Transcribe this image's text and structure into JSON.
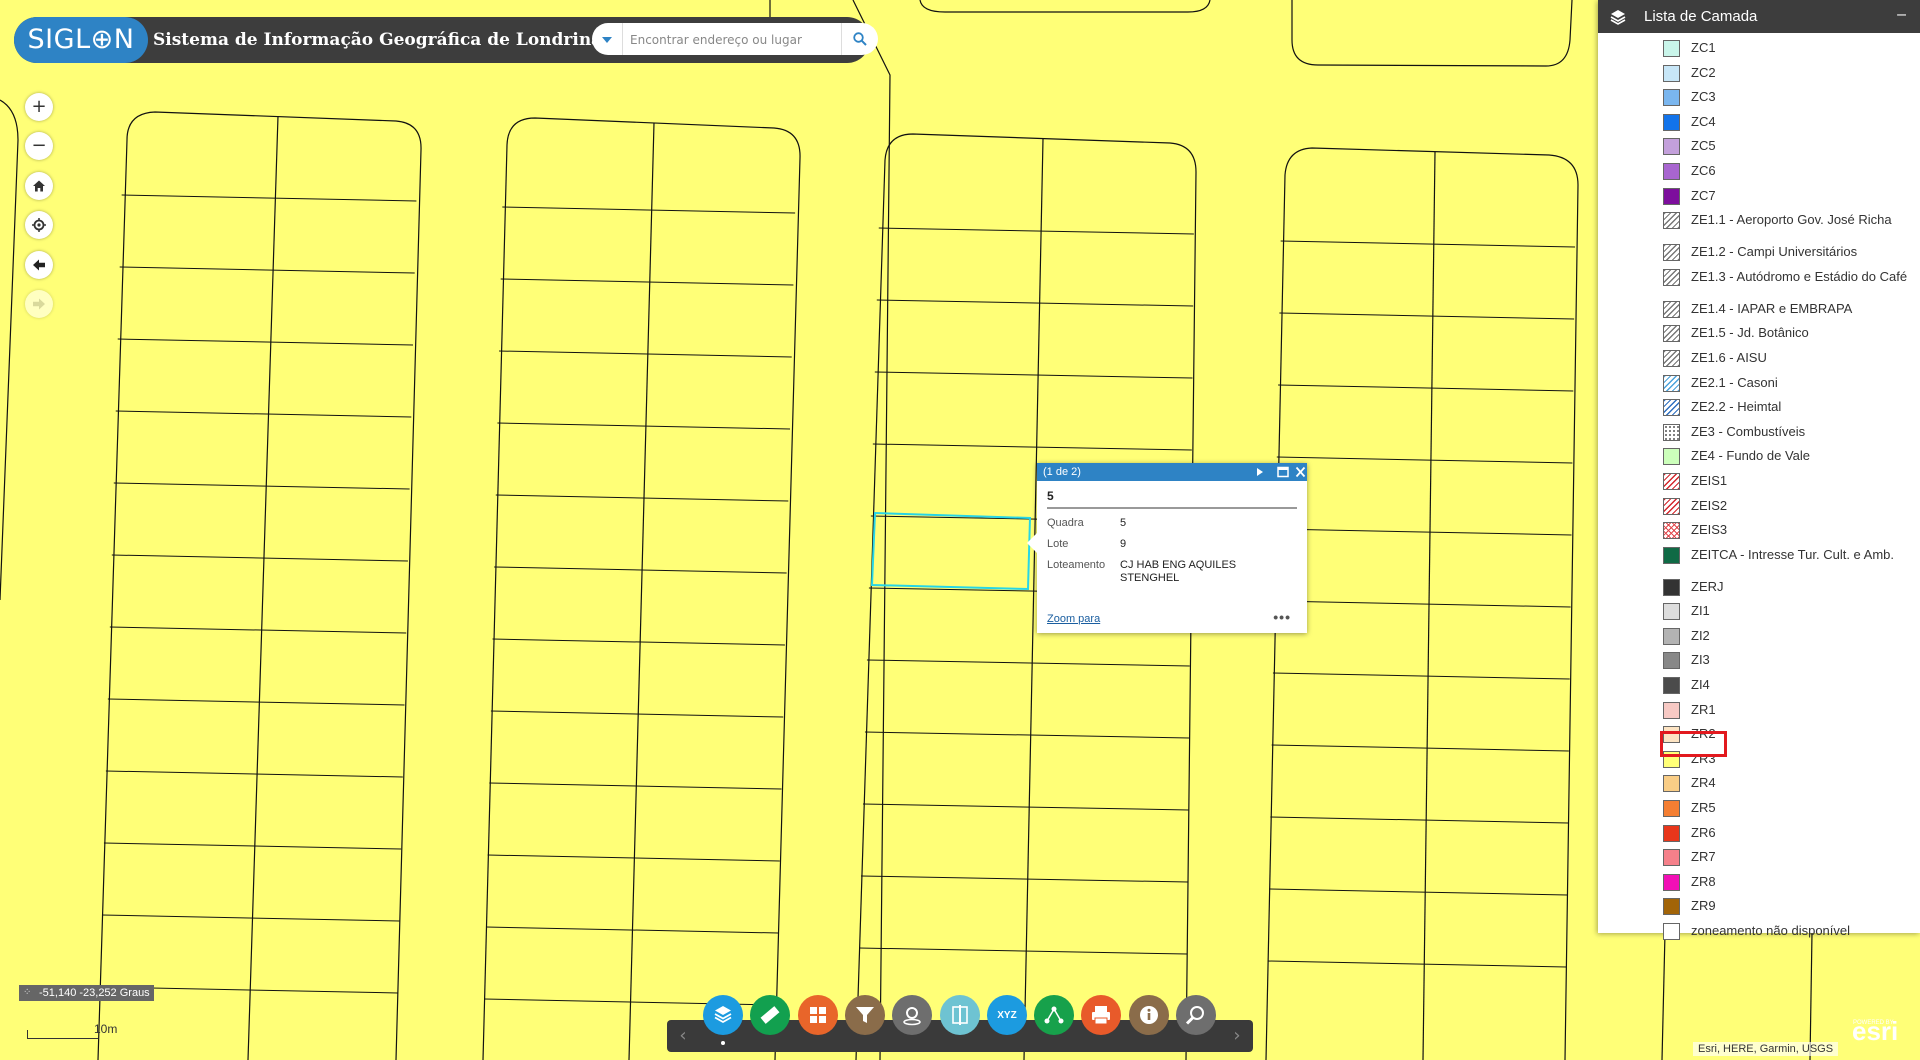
{
  "header": {
    "logo_text": "SIGL⊕N",
    "title": "Sistema de Informação Geográfica de Londrina"
  },
  "search": {
    "placeholder": "Encontrar endereço ou lugar"
  },
  "map_controls": {
    "zoom_in": "+",
    "zoom_out": "−"
  },
  "popup": {
    "counter": "(1 de 2)",
    "title": "5",
    "fields": [
      {
        "key": "Quadra",
        "value": "5"
      },
      {
        "key": "Lote",
        "value": "9"
      },
      {
        "key": "Loteamento",
        "value": "CJ HAB ENG AQUILES STENGHEL"
      }
    ],
    "zoom_link": "Zoom para",
    "more": "•••"
  },
  "layer_list": {
    "title": "Lista de Camada",
    "minimize": "–",
    "items": [
      {
        "label": "ZC1",
        "color": "#c9f5ea",
        "pattern": "solid"
      },
      {
        "label": "ZC2",
        "color": "#c7e6f7",
        "pattern": "solid"
      },
      {
        "label": "ZC3",
        "color": "#7ab6ef",
        "pattern": "solid"
      },
      {
        "label": "ZC4",
        "color": "#1273ea",
        "pattern": "solid"
      },
      {
        "label": "ZC5",
        "color": "#c3a0db",
        "pattern": "solid"
      },
      {
        "label": "ZC6",
        "color": "#a865d0",
        "pattern": "solid"
      },
      {
        "label": "ZC7",
        "color": "#7d0e9d",
        "pattern": "solid"
      },
      {
        "label": "ZE1.1 - Aeroporto Gov. José Richa",
        "color": "#777777",
        "pattern": "hatch"
      },
      {
        "label": "ZE1.2 - Campi Universitários",
        "color": "#777777",
        "pattern": "hatch"
      },
      {
        "label": "ZE1.3 - Autódromo e Estádio do Café",
        "color": "#777777",
        "pattern": "hatch"
      },
      {
        "label": "ZE1.4 - IAPAR e EMBRAPA",
        "color": "#777777",
        "pattern": "hatch"
      },
      {
        "label": "ZE1.5 - Jd. Botânico",
        "color": "#777777",
        "pattern": "hatch"
      },
      {
        "label": "ZE1.6 - AISU",
        "color": "#777777",
        "pattern": "hatch"
      },
      {
        "label": "ZE2.1 - Casoni",
        "color": "#4aa3dc",
        "pattern": "hatch"
      },
      {
        "label": "ZE2.2 - Heimtal",
        "color": "#2e6fc0",
        "pattern": "hatch"
      },
      {
        "label": "ZE3 - Combustíveis",
        "color": "#555555",
        "pattern": "dots"
      },
      {
        "label": "ZE4 - Fundo de Vale",
        "color": "#ccffbb",
        "pattern": "solid"
      },
      {
        "label": "ZEIS1",
        "color": "#d4262c",
        "pattern": "hatch"
      },
      {
        "label": "ZEIS2",
        "color": "#d4262c",
        "pattern": "hatch"
      },
      {
        "label": "ZEIS3",
        "color": "#e0474c",
        "pattern": "cross"
      },
      {
        "label": "ZEITCA - Intresse Tur. Cult. e Amb.",
        "color": "#0f6a45",
        "pattern": "solid"
      },
      {
        "label": "ZERJ",
        "color": "#333333",
        "pattern": "solid"
      },
      {
        "label": "ZI1",
        "color": "#dddddd",
        "pattern": "solid"
      },
      {
        "label": "ZI2",
        "color": "#b3b3b3",
        "pattern": "solid"
      },
      {
        "label": "ZI3",
        "color": "#888888",
        "pattern": "solid"
      },
      {
        "label": "ZI4",
        "color": "#4b4b4b",
        "pattern": "solid"
      },
      {
        "label": "ZR1",
        "color": "#f7c9c4",
        "pattern": "solid"
      },
      {
        "label": "ZR2",
        "color": "#fde4c3",
        "pattern": "solid"
      },
      {
        "label": "ZR3",
        "color": "#ffff77",
        "pattern": "solid"
      },
      {
        "label": "ZR4",
        "color": "#f9cd86",
        "pattern": "solid"
      },
      {
        "label": "ZR5",
        "color": "#f47e32",
        "pattern": "solid"
      },
      {
        "label": "ZR6",
        "color": "#e8361b",
        "pattern": "solid"
      },
      {
        "label": "ZR7",
        "color": "#f5808a",
        "pattern": "solid"
      },
      {
        "label": "ZR8",
        "color": "#f20fb6",
        "pattern": "solid"
      },
      {
        "label": "ZR9",
        "color": "#a26408",
        "pattern": "solid"
      },
      {
        "label": "zoneamento não disponível",
        "color": "#ffffff",
        "pattern": "solid"
      }
    ]
  },
  "toolbar": {
    "tools": [
      {
        "name": "layer-list-tool",
        "color": "#1c9be0",
        "icon": "layers-icon"
      },
      {
        "name": "measure-tool",
        "color": "#12a04f",
        "icon": "ruler-icon"
      },
      {
        "name": "basemap-tool",
        "color": "#e8652a",
        "icon": "grid-icon"
      },
      {
        "name": "filter-tool",
        "color": "#8a6c4a",
        "icon": "filter-icon"
      },
      {
        "name": "draw-tool",
        "color": "#6e6e6e",
        "icon": "location-edit-icon"
      },
      {
        "name": "swipe-tool",
        "color": "#6ec3d2",
        "icon": "swipe-icon"
      },
      {
        "name": "coordinate-tool",
        "color": "#1c9be0",
        "icon": "xyz-icon"
      },
      {
        "name": "share-tool",
        "color": "#17a14b",
        "icon": "share-icon"
      },
      {
        "name": "print-tool",
        "color": "#e85a2a",
        "icon": "printer-icon"
      },
      {
        "name": "about-tool",
        "color": "#8a6c4a",
        "icon": "info-icon"
      },
      {
        "name": "query-tool",
        "color": "#6e6e6e",
        "icon": "zoom-search-icon"
      }
    ],
    "xyz_text": "XYZ"
  },
  "status": {
    "coordinates": "-51,140 -23,252 Graus",
    "scale_label": "10m",
    "attribution": "Esri, HERE, Garmin, USGS",
    "esri_logo": "esri",
    "powered_by": "POWERED BY"
  },
  "colors": {
    "map_fill": "#ffff77",
    "header_bg": "#3d3d3d",
    "accent": "#2e83c5",
    "selection": "#27d6e6",
    "highlight": "#e2191e"
  }
}
